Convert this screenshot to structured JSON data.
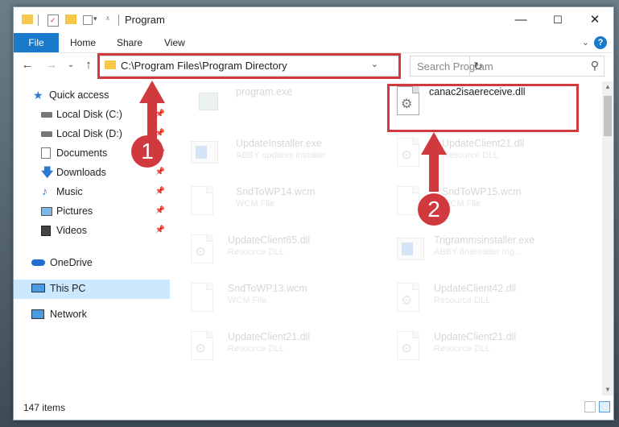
{
  "window": {
    "title": "Program",
    "controls": {
      "minimize": "—",
      "maximize": "☐",
      "close": "✕"
    }
  },
  "ribbon": {
    "tabs": [
      "File",
      "Home",
      "Share",
      "View"
    ],
    "help_icon": "?"
  },
  "navigation": {
    "address": "C:\\Program Files\\Program Directory",
    "search_placeholder": "Search Program"
  },
  "sidebar": {
    "items": [
      {
        "label": "Quick access",
        "icon": "star-icon",
        "pinned": false
      },
      {
        "label": "Local Disk (C:)",
        "icon": "drive-icon",
        "pinned": true
      },
      {
        "label": "Local Disk (D:)",
        "icon": "drive-icon",
        "pinned": true
      },
      {
        "label": "Documents",
        "icon": "documents-icon",
        "pinned": true
      },
      {
        "label": "Downloads",
        "icon": "download-icon",
        "pinned": true
      },
      {
        "label": "Music",
        "icon": "music-icon",
        "pinned": true
      },
      {
        "label": "Pictures",
        "icon": "pictures-icon",
        "pinned": true
      },
      {
        "label": "Videos",
        "icon": "videos-icon",
        "pinned": true
      },
      {
        "label": "OneDrive",
        "icon": "cloud-icon",
        "pinned": false
      },
      {
        "label": "This PC",
        "icon": "computer-icon",
        "pinned": false,
        "selected": true
      },
      {
        "label": "Network",
        "icon": "network-icon",
        "pinned": false
      }
    ]
  },
  "files": [
    {
      "name": "program.exe",
      "type": "",
      "icon": "program-icon",
      "faded": true
    },
    {
      "name": "canac2isaereceive.dll",
      "type": "",
      "icon": "dll-icon",
      "faded": false,
      "highlighted": true
    },
    {
      "name": "UpdateInstaller.exe",
      "type": "ABBY updates installer",
      "icon": "exe-icon",
      "faded": true
    },
    {
      "name": "UpdateClient21.dll",
      "type": "Resource DLL",
      "icon": "dll-icon",
      "faded": true
    },
    {
      "name": "SndToWP14.wcm",
      "type": "WCM File",
      "icon": "file-icon",
      "faded": true
    },
    {
      "name": "SndToWP15.wcm",
      "type": "WCM File",
      "icon": "file-icon",
      "faded": true
    },
    {
      "name": "UpdateClient65.dll",
      "type": "Resource DLL",
      "icon": "dll-icon",
      "faded": true
    },
    {
      "name": "Trigrammsinstaller.exe",
      "type": "ABBY finereader trig...",
      "icon": "exe-icon",
      "faded": true
    },
    {
      "name": "SndToWP13.wcm",
      "type": "WCM File",
      "icon": "file-icon",
      "faded": true
    },
    {
      "name": "UpdateClient42.dll",
      "type": "Resource DLL",
      "icon": "dll-icon",
      "faded": true
    },
    {
      "name": "UpdateClient21.dll",
      "type": "Resource DLL",
      "icon": "dll-icon",
      "faded": true
    },
    {
      "name": "UpdateClient21.dll",
      "type": "Resource DLL",
      "icon": "dll-icon",
      "faded": true
    }
  ],
  "status": {
    "item_count": "147 items"
  },
  "annotations": {
    "step1": "1",
    "step2": "2",
    "color": "#d0393e"
  }
}
